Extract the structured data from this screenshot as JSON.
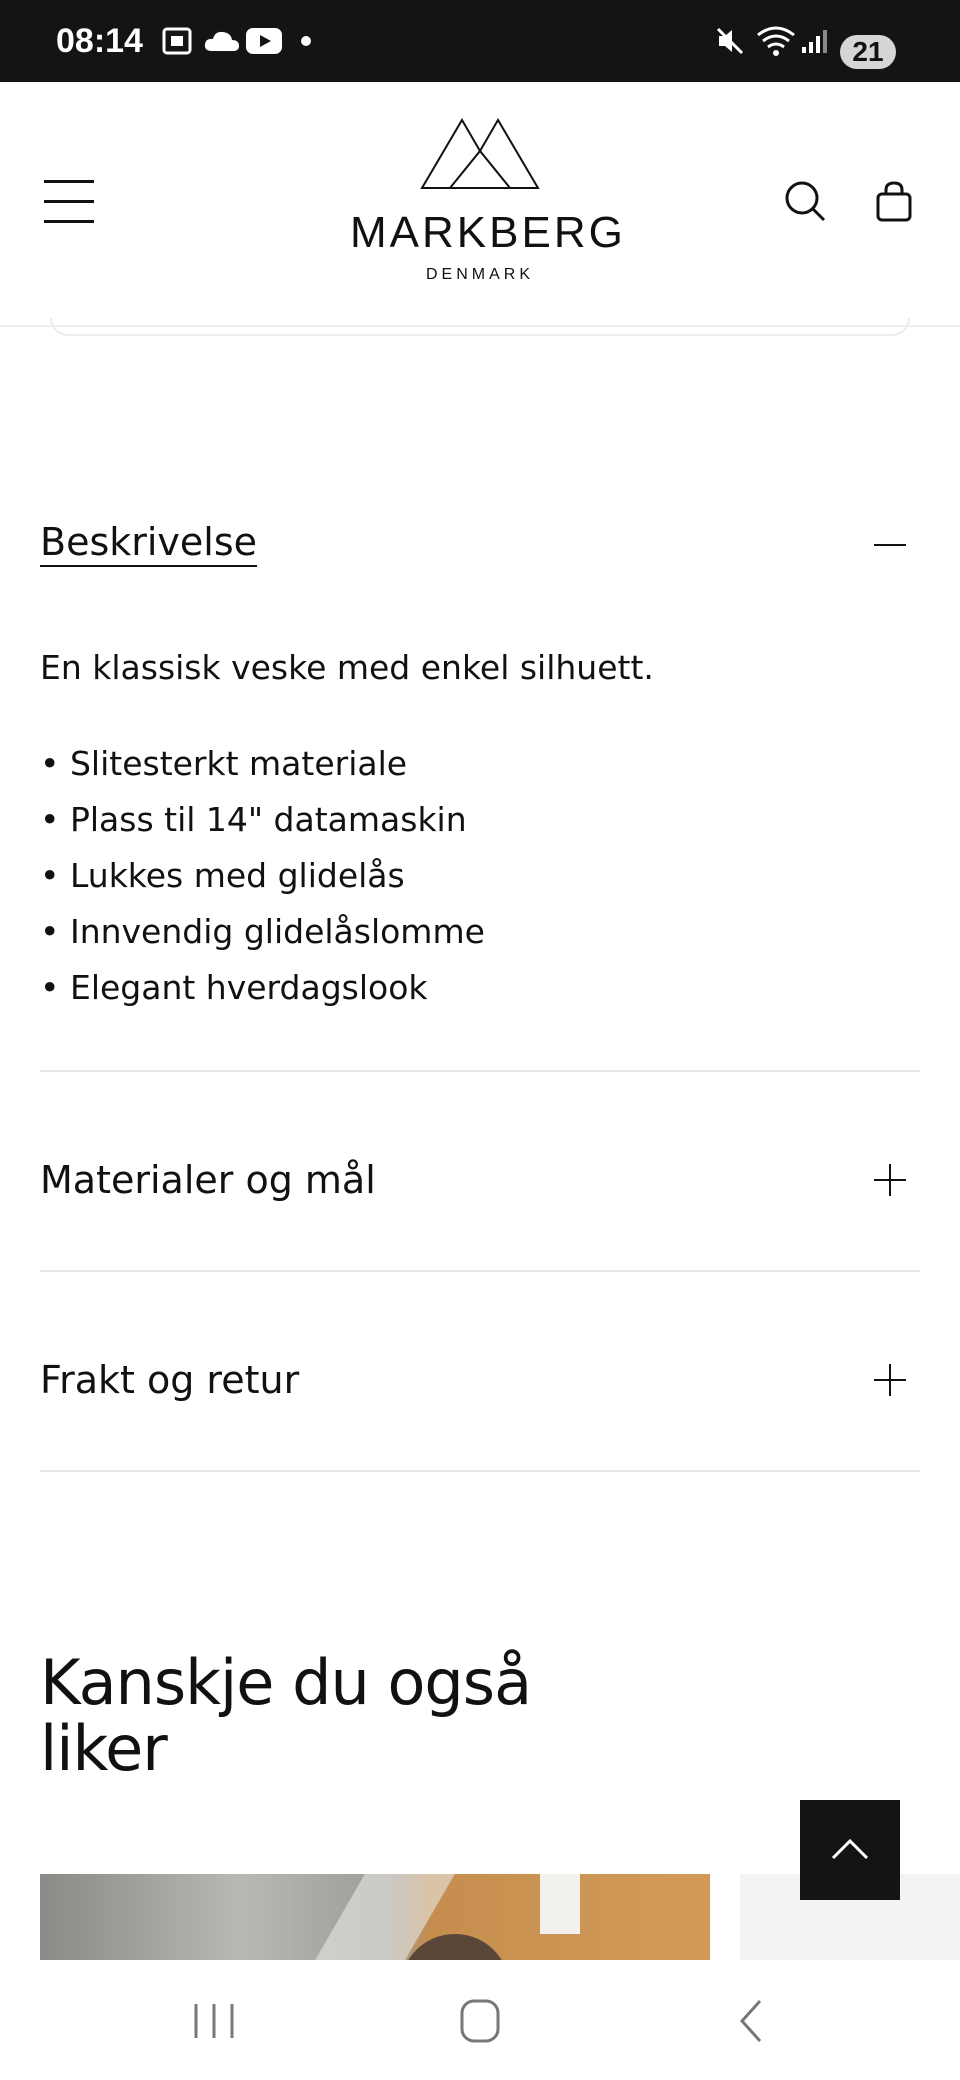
{
  "status_bar": {
    "time": "08:14",
    "battery": "21",
    "icons": [
      "screenshot-icon",
      "cloud-icon",
      "youtube-icon",
      "notification-dot-icon",
      "mute-icon",
      "wifi-icon",
      "signal-icon"
    ]
  },
  "header": {
    "brand": "MARKBERG",
    "brand_sub": "DENMARK",
    "icons": [
      "hamburger-menu-icon",
      "search-icon",
      "shopping-bag-icon"
    ]
  },
  "description": {
    "title": "Beskrivelse",
    "intro": "En klassisk veske med enkel silhuett.",
    "bullets": [
      "Slitesterkt materiale",
      "Plass til 14\" datamaskin",
      "Lukkes med glidelås",
      "Innvendig glidelåslomme",
      "Elegant hverdagslook"
    ]
  },
  "accordion": {
    "materials_label": "Materialer og mål",
    "shipping_label": "Frakt og retur"
  },
  "recommendations": {
    "heading": "Kanskje du også liker"
  },
  "colors": {
    "text": "#111111",
    "divider": "#e6e6e6",
    "status_bar": "#141414",
    "back_to_top": "#141414"
  }
}
